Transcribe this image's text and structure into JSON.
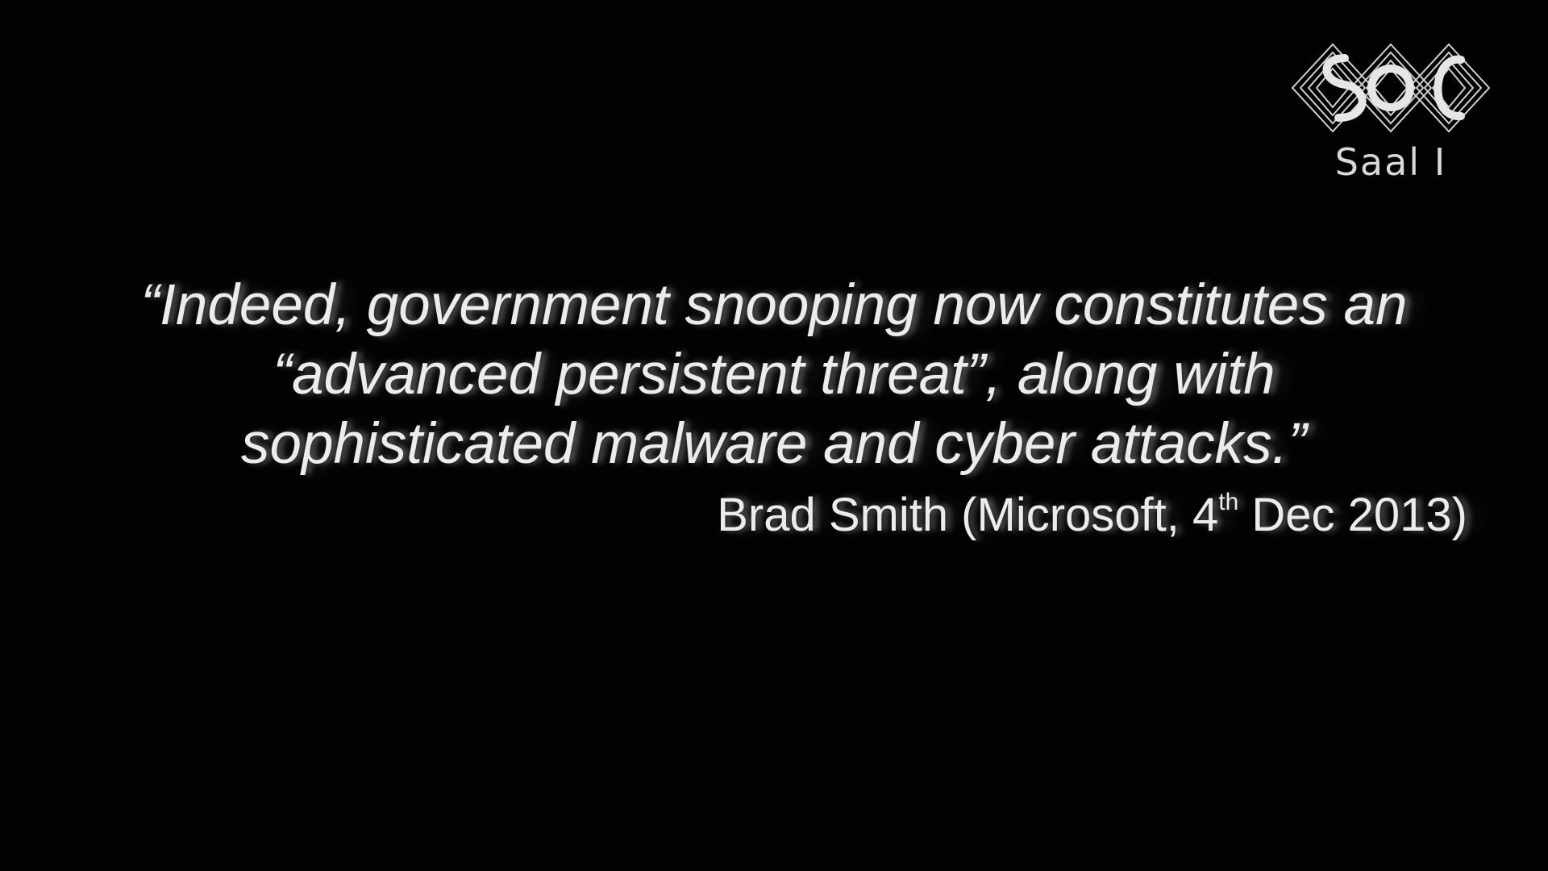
{
  "logo": {
    "icon": "conference-logo-icon",
    "room_label": "Saal I",
    "color": "#d8d8d8"
  },
  "quote": {
    "lines": [
      "“Indeed, government snooping now constitutes an",
      "“advanced persistent threat”, along with",
      "sophisticated malware and cyber attacks.”"
    ]
  },
  "attribution": {
    "before_sup": "Brad Smith (Microsoft, 4",
    "sup": "th",
    "after_sup": " Dec 2013)"
  },
  "colors": {
    "background": "#020202",
    "text": "#ececec"
  }
}
